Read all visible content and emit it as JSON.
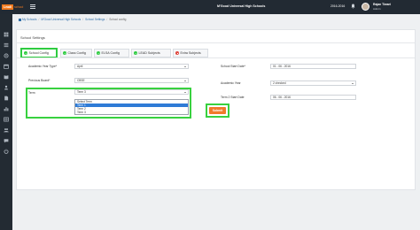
{
  "brand": {
    "logo_box": "Leadi",
    "logo_text": "school"
  },
  "header": {
    "school": "M'Good Universal High Schools",
    "year": "2016-2016",
    "user_name": "Rajan Tiwari",
    "user_role": "Admin"
  },
  "breadcrumb": [
    "My Schools",
    "M'Good Universal High Schools",
    "School Settings",
    "School config"
  ],
  "panel_title": "School Settings",
  "tabs": [
    {
      "label": "School Config",
      "icon": "check-circle-icon"
    },
    {
      "label": "Class Config",
      "icon": "check-circle-icon"
    },
    {
      "label": "ELSA Config",
      "icon": "check-circle-icon"
    },
    {
      "label": "LEAD Subjects",
      "icon": "check-circle-icon"
    },
    {
      "label": "Extra Subjects",
      "icon": "close-circle-icon"
    }
  ],
  "form": {
    "academic_year_type_label": "Academic Year Type*",
    "academic_year_type_value": "April",
    "previous_board_label": "Previous Board*",
    "previous_board_value": "CBSE",
    "term_label": "Term",
    "term_value": "Term 3",
    "term_options": [
      "Select Term",
      "Term 1",
      "Term 2",
      "Term 3"
    ],
    "term_selected_index": 1,
    "school_start_date_label": "School Start Date*",
    "school_start_date_value": "01 - 06 - 2016",
    "academic_year_label": "Academic Year",
    "academic_year_value": "2 checked",
    "term2_start_label": "Term 2 Start Date",
    "term2_start_value": "06 - 06 - 2016",
    "submit_label": "Submit"
  },
  "colors": {
    "accent": "#f07a2a",
    "highlight": "#38d13f",
    "sidebar": "#232b33",
    "selected": "#2f7bd6"
  }
}
